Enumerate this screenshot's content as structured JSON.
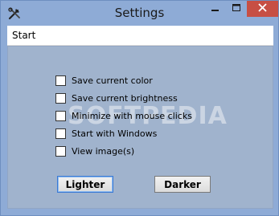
{
  "window": {
    "title": "Settings",
    "icon": "tools-icon",
    "controls": {
      "minimize": "minimize-icon",
      "maximize": "maximize-icon",
      "close": "close-icon"
    }
  },
  "menu": {
    "items": [
      {
        "label": "Start"
      }
    ]
  },
  "options": [
    {
      "label": "Save current color",
      "checked": false
    },
    {
      "label": "Save current brightness",
      "checked": false
    },
    {
      "label": "Minimize with mouse clicks",
      "checked": false
    },
    {
      "label": "Start with Windows",
      "checked": false
    },
    {
      "label": "View image(s)",
      "checked": false
    }
  ],
  "buttons": {
    "lighter": "Lighter",
    "darker": "Darker"
  },
  "watermark": "SOFTPEDIA",
  "colors": {
    "frame": "#8eabd6",
    "client": "#a0b3cd",
    "close": "#c74f44"
  }
}
